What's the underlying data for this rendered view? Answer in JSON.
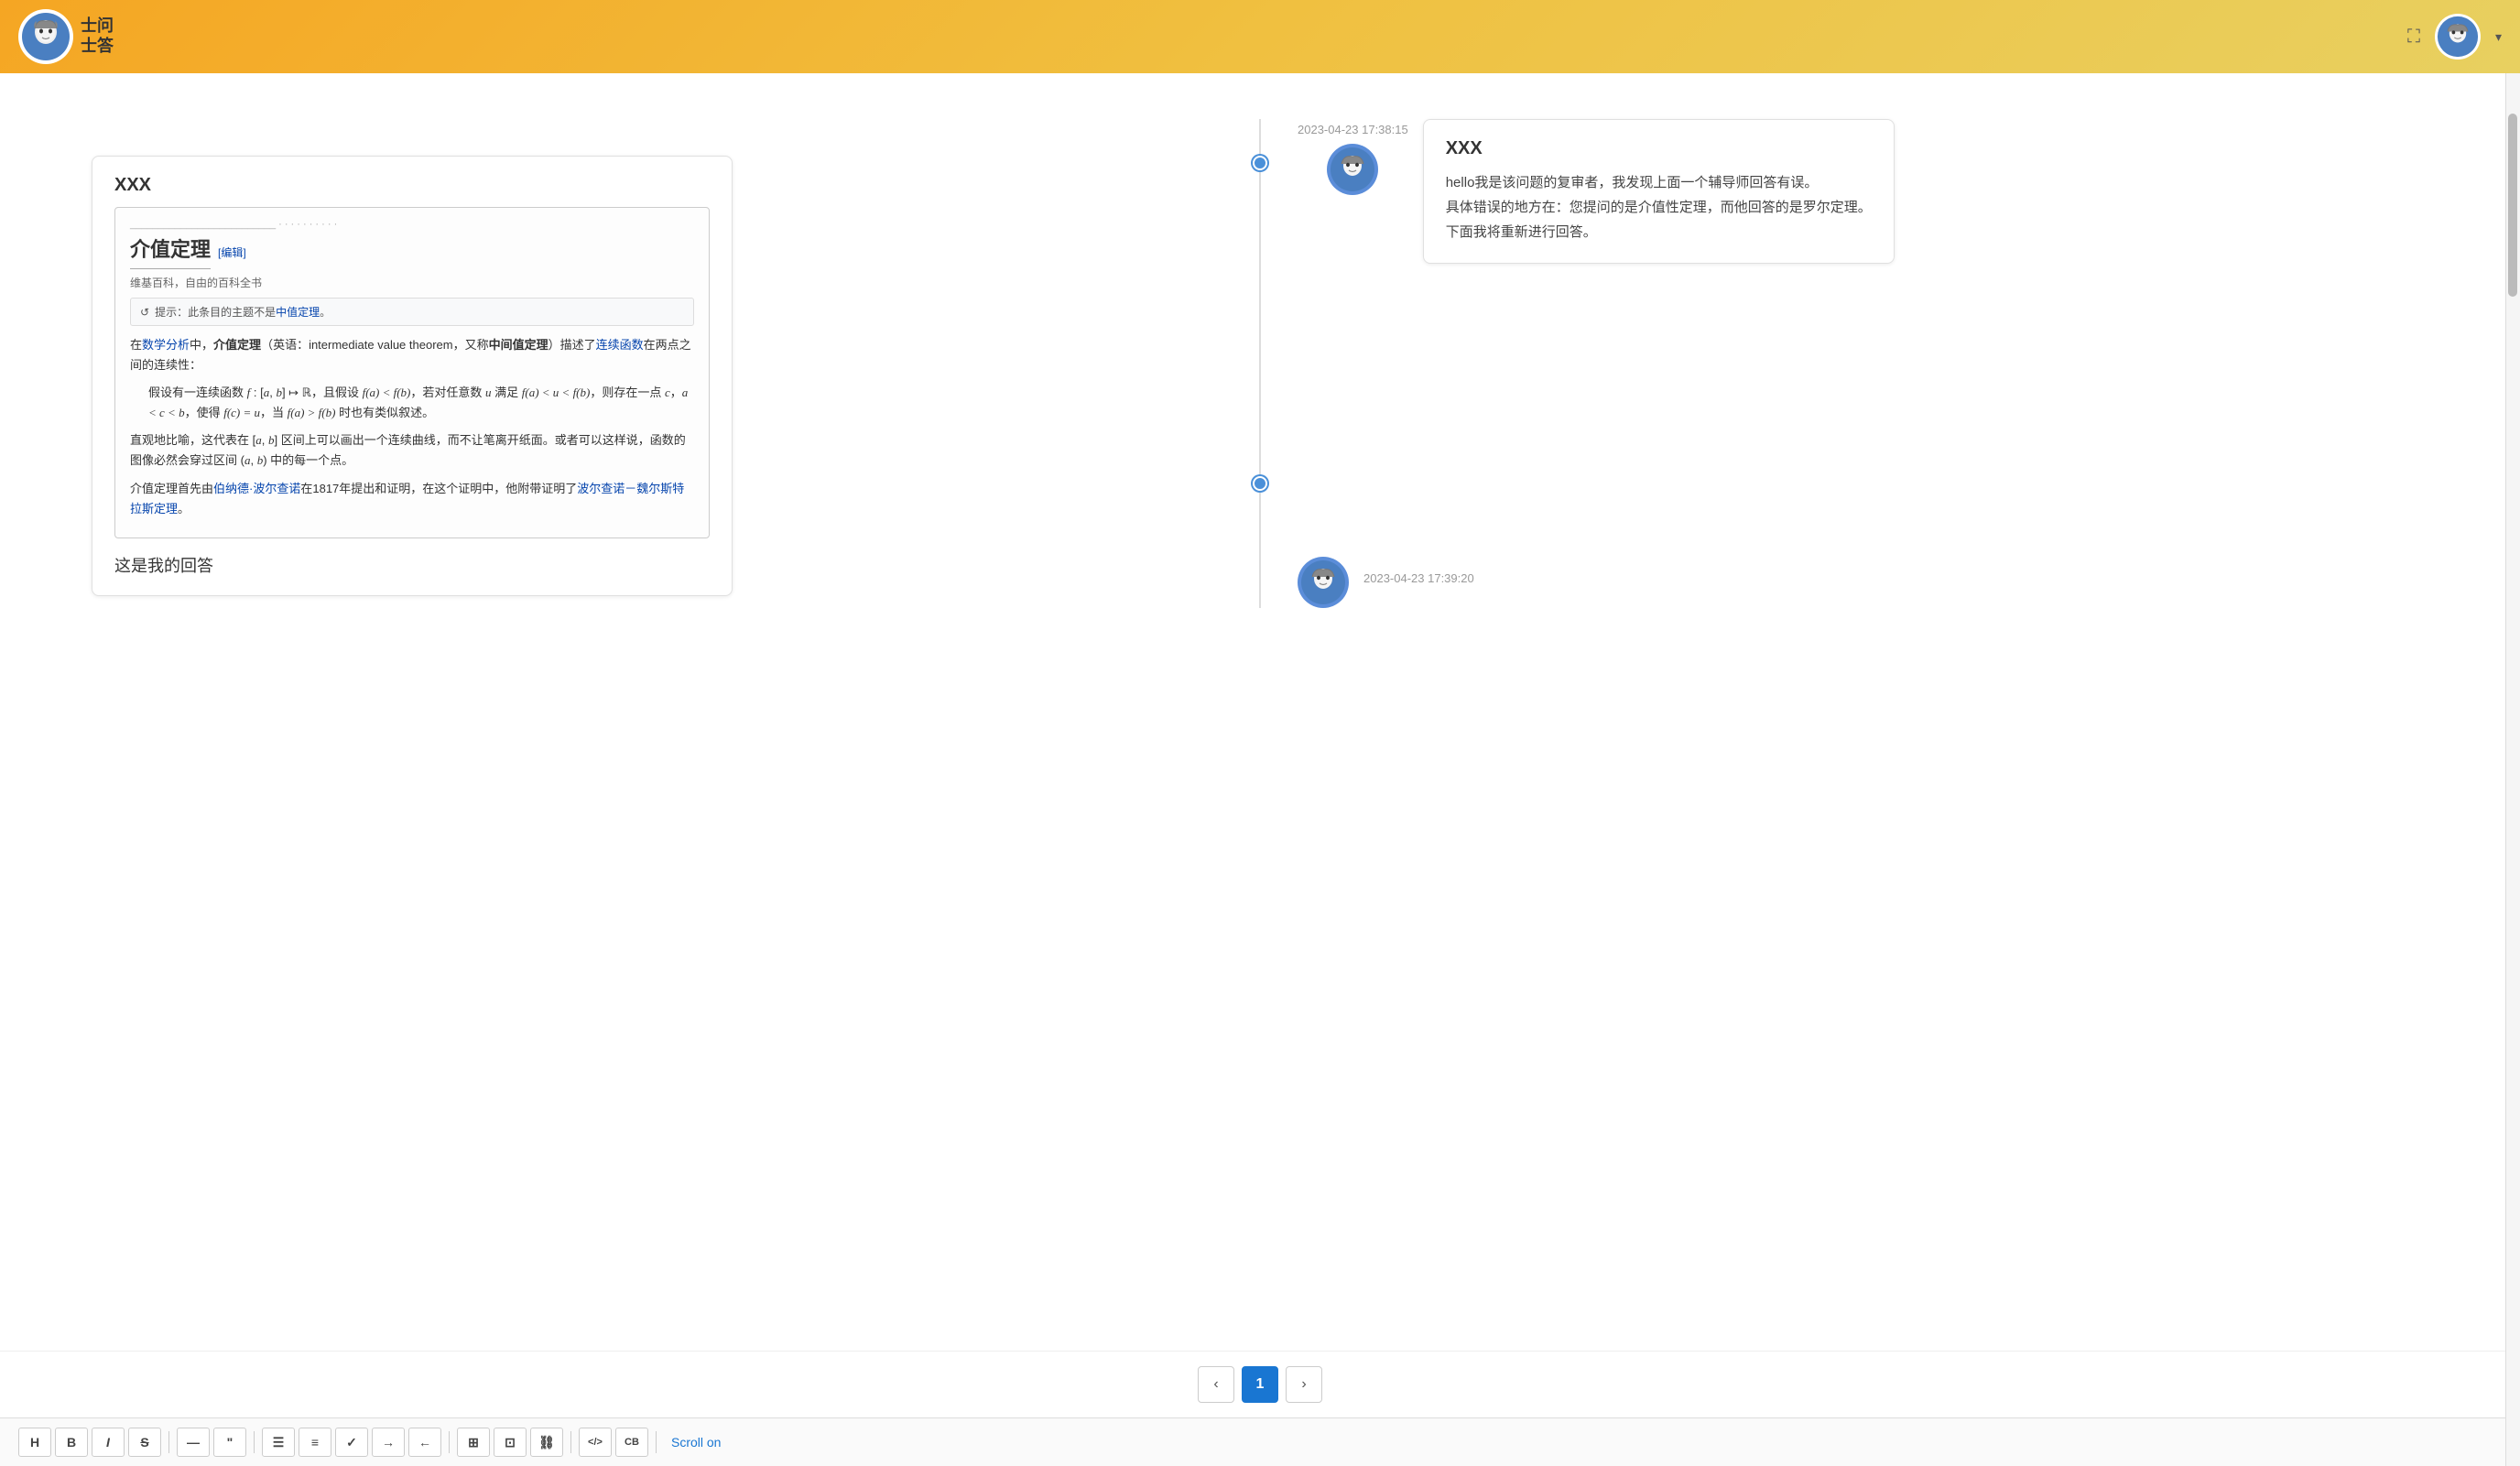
{
  "header": {
    "logo_text_line1": "士问",
    "logo_text_line2": "士答",
    "expand_icon": "⛶",
    "dropdown_arrow": "▾"
  },
  "conversation": {
    "msg1": {
      "timestamp": "2023-04-23 17:38:15",
      "title": "XXX",
      "reviewer_text_line1": "hello我是该问题的复审者，我发现上面一个辅导师回答有误。",
      "reviewer_text_line2": "具体错误的地方在：您提问的是介值性定理，而他回答的是罗尔定理。",
      "reviewer_text_line3": "下面我将重新进行回答。"
    },
    "msg2": {
      "title": "XXX",
      "wiki_title": "介值定理",
      "wiki_edit": "[编辑]",
      "wiki_source": "维基百科，自由的百科全书",
      "wiki_notice": "提示：此条目的主题不是中值定理。",
      "wiki_notice_link": "中值定理",
      "wiki_p1": "在数学分析中，介值定理（英语：intermediate value theorem，又称中间值定理）描述了连续函数在两点之间的连续性：",
      "wiki_p2": "假设有一连续函数 f : [a, b] ↦ ℝ，且假设 f(a) < f(b)，若对任意数 u 满足 f(a) < u < f(b)，则存在一点 c，a < c < b，使得 f(c) = u，当 f(a) > f(b) 时也有类似叙述。",
      "wiki_p3": "直观地比喻，这代表在 [a, b] 区间上可以画出一个连续曲线，而不让笔离开纸面。或者可以这样说，函数的图像必然会穿过区间 (a, b) 中的每一个点。",
      "wiki_p4_start": "介值定理首先由",
      "wiki_p4_link1": "伯纳德·波尔查诺",
      "wiki_p4_mid": "在1817年提出和证明，在这个证明中，他附带证明了",
      "wiki_p4_link2": "波尔查诺－魏尔斯特拉斯定理",
      "wiki_p4_end": "。",
      "answer_text": "这是我的回答",
      "timestamp": "2023-04-23 17:39:20"
    }
  },
  "pagination": {
    "prev_label": "‹",
    "page1_label": "1",
    "next_label": "›"
  },
  "toolbar": {
    "buttons": [
      {
        "id": "h",
        "label": "H"
      },
      {
        "id": "b",
        "label": "B"
      },
      {
        "id": "i",
        "label": "I"
      },
      {
        "id": "s",
        "label": "S"
      },
      {
        "id": "hr",
        "label": "—"
      },
      {
        "id": "quote",
        "label": "\""
      },
      {
        "id": "ul",
        "label": "≡"
      },
      {
        "id": "ol",
        "label": "≡"
      },
      {
        "id": "check",
        "label": "✓"
      },
      {
        "id": "indent",
        "label": "→"
      },
      {
        "id": "outdent",
        "label": "←"
      },
      {
        "id": "table",
        "label": "⊞"
      },
      {
        "id": "image",
        "label": "⊡"
      },
      {
        "id": "link",
        "label": "⛓"
      },
      {
        "id": "code",
        "label": "</>"
      },
      {
        "id": "cb",
        "label": "CB"
      }
    ],
    "scroll_on_label": "Scroll on"
  }
}
